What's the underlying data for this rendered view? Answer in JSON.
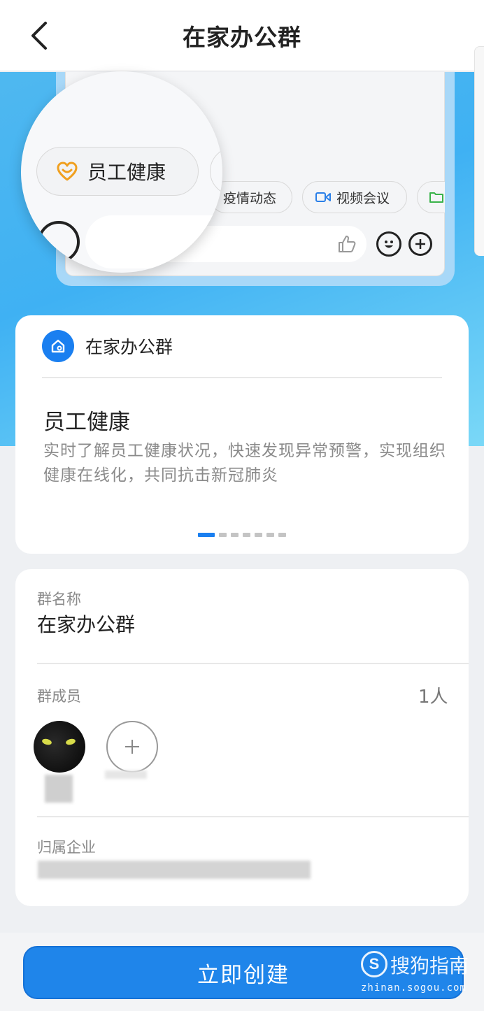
{
  "header": {
    "title": "在家办公群"
  },
  "preview": {
    "magnified_chip": "员工健康",
    "chips": [
      "疫情动态",
      "视频会议"
    ]
  },
  "feature_card": {
    "app_name": "在家办公群",
    "title": "员工健康",
    "description": "实时了解员工健康状况，快速发现异常预警，实现组织健康在线化，共同抗击新冠肺炎",
    "carousel": {
      "total": 7,
      "active": 1
    }
  },
  "group_info": {
    "name_label": "群名称",
    "name_value": "在家办公群",
    "members_label": "群成员",
    "members_count": "1人",
    "enterprise_label": "归属企业"
  },
  "footer": {
    "create_button": "立即创建"
  },
  "watermark": {
    "brand": "搜狗指南",
    "url": "zhinan.sogou.com"
  },
  "colors": {
    "primary": "#1f85ea",
    "banner": "#3fb1f3",
    "health_icon": "#f0a020",
    "video_icon": "#2a7fe8",
    "folder_icon": "#3ab34a"
  }
}
